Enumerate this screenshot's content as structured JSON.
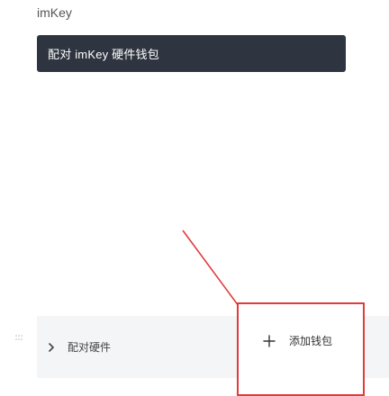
{
  "header": {
    "title": "imKey"
  },
  "actions": {
    "primary_label": "配对 imKey 硬件钱包"
  },
  "row": {
    "label": "配对硬件"
  },
  "addon": {
    "label": "添加钱包"
  },
  "icons": {
    "chevron": "chevron-right-icon",
    "plus": "plus-icon",
    "dots": "drag-dots-icon"
  },
  "colors": {
    "primary_button": "#2f3540",
    "highlight": "#e23b3b",
    "strip": "#f4f5f7"
  }
}
